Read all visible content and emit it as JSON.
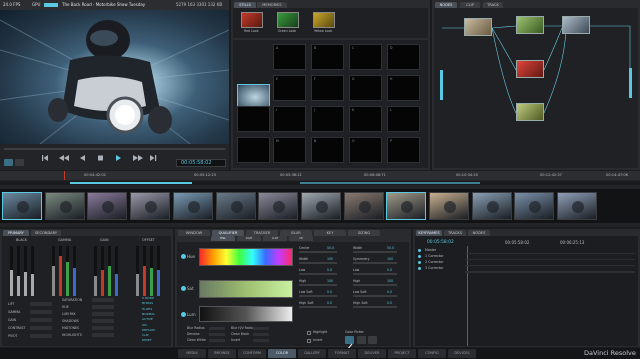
{
  "viewer": {
    "fps": "24.0 FPS",
    "gpu": "GPU",
    "clip_title": "The Back Road - Motorbike Show Tuesday",
    "clip_info": "5279 163 3301 132 KB",
    "timecode": "00:05:58:02",
    "transport_icons": [
      "skip-start-icon",
      "step-back-icon",
      "play-reverse-icon",
      "stop-icon",
      "play-icon",
      "step-forward-icon",
      "skip-end-icon"
    ]
  },
  "gallery": {
    "tabs": [
      "STILLS",
      "MEMORIES"
    ],
    "stills": [
      {
        "label": "Red Look",
        "color": "#c23a2a"
      },
      {
        "label": "Green Look",
        "color": "#3a9a3e"
      },
      {
        "label": "Yellow Look",
        "color": "#c8a52a"
      }
    ],
    "memory_labels": [
      "A",
      "B",
      "C",
      "D",
      "E",
      "F",
      "G",
      "H",
      "I",
      "J",
      "K",
      "L",
      "M",
      "N",
      "O",
      "P"
    ]
  },
  "node_editor": {
    "tabs": [
      "NODES",
      "CLIP",
      "TRACK"
    ],
    "nodes": [
      {
        "id": "01",
        "color": "#b0a28a"
      },
      {
        "id": "02",
        "color": "#7ea85a"
      },
      {
        "id": "03",
        "color": "#8a9aa8"
      },
      {
        "id": "04",
        "color": "#c0302c"
      },
      {
        "id": "05",
        "color": "#a0b06a"
      }
    ]
  },
  "timeline": {
    "timecodes": [
      "00:04:42:02",
      "00:05:12:23",
      "00:05:36:21",
      "00:06:08:71",
      "00:10:34:20",
      "00:12:42:37",
      "00:14:47:06"
    ],
    "clip_count": 14
  },
  "primaries": {
    "tabs": [
      "PRIMARY",
      "SECONDARY"
    ],
    "wheels": [
      "BLACK",
      "GAMMA",
      "GAIN",
      "OFFSET"
    ],
    "params_left": [
      "LIFT",
      "GAMMA",
      "GAIN",
      "CONTRAST",
      "PIVOT"
    ],
    "params_right": [
      "SATURATION",
      "HUE",
      "LUM MIX",
      "SHADOWS",
      "MIDTONES",
      "HIGHLIGHTS"
    ],
    "right_values": [
      "0 MODE",
      "BYPASS",
      "HI-RES",
      "NORMAL",
      "ACTIVE",
      "ON",
      "DEFAULT",
      "CLIP",
      "RESET"
    ]
  },
  "qualifier": {
    "tabs": [
      "WINDOW",
      "QUALIFIER",
      "TRACKER",
      "BLUR",
      "KEY",
      "SIZING"
    ],
    "sub_tabs": [
      "HSL",
      "RGB",
      "LUM",
      "3D"
    ],
    "rows": [
      "Hue",
      "Sat",
      "Lum"
    ],
    "col_a": [
      "Center",
      "Width",
      "Low",
      "High",
      "Low Soft",
      "High Soft"
    ],
    "col_b": [
      "Width",
      "Symmetry",
      "Low",
      "High",
      "Low Soft",
      "High Soft"
    ],
    "values": [
      "50.0",
      "100",
      "0.0",
      "100",
      "0.0",
      "0.0"
    ],
    "bottom_labels": [
      "Blur Radius",
      "Blur H/V Ratio",
      "Denoise",
      "Clean Black",
      "Clean White",
      "Invert"
    ],
    "checkbox_labels": [
      "Highlight",
      "Invert"
    ],
    "color_picker": "Color Picker"
  },
  "keyframes": {
    "tabs": [
      "KEYFRAMES",
      "TRACKS",
      "NODES"
    ],
    "timecode_a": "00:05:58:02",
    "timecode_b": "00:05:58:02",
    "timecode_c": "00:06:25:13",
    "tracks": [
      "Master",
      "1 Corrector",
      "2 Corrector",
      "3 Corrector"
    ]
  },
  "pages": [
    "MEDIA",
    "BROWSE",
    "CONFORM",
    "COLOR",
    "GALLERY",
    "FORMAT",
    "DELIVER",
    "PROJECT",
    "CONFIG",
    "DEVICES"
  ],
  "active_page": "COLOR",
  "brand": "DaVinci Resolve",
  "colors": {
    "accent": "#5ac8e0",
    "background": "#1b1c1e",
    "panel": "#2a2b2e"
  }
}
